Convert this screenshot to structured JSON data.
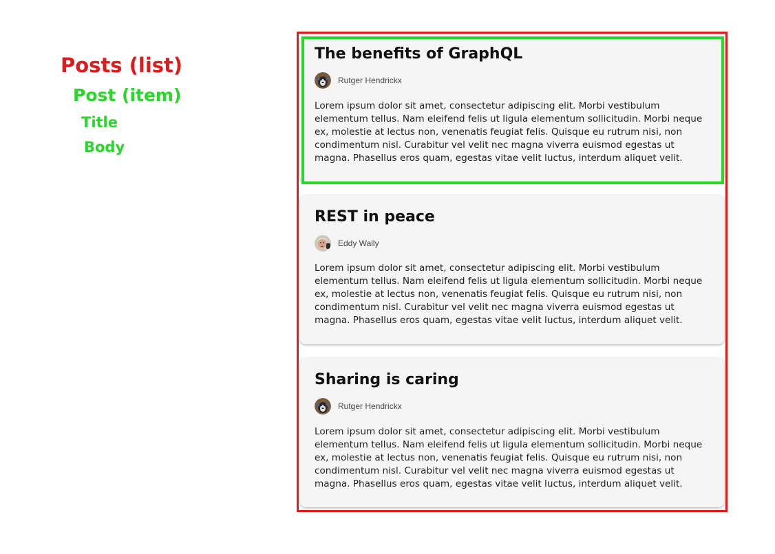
{
  "legend": {
    "list_label": "Posts (list)",
    "item_label": "Post (item)",
    "title_label": "Title",
    "body_label": "Body"
  },
  "colors": {
    "list_outline": "#e11b1b",
    "item_outline": "#2bd62b"
  },
  "posts": [
    {
      "title": "The benefits of GraphQL",
      "author": "Rutger Hendrickx",
      "avatar_icon": "dog-avatar-icon",
      "body": "Lorem ipsum dolor sit amet, consectetur adipiscing elit. Morbi vestibulum elementum tellus. Nam eleifend felis ut ligula elementum sollicitudin. Morbi neque ex, molestie at lectus non, venenatis feugiat felis. Quisque eu rutrum nisi, non condimentum nisl. Curabitur vel velit nec magna viverra euismod egestas ut magna. Phasellus eros quam, egestas vitae velit luctus, interdum aliquet velit."
    },
    {
      "title": "REST in peace",
      "author": "Eddy Wally",
      "avatar_icon": "person-avatar-icon",
      "body": "Lorem ipsum dolor sit amet, consectetur adipiscing elit. Morbi vestibulum elementum tellus. Nam eleifend felis ut ligula elementum sollicitudin. Morbi neque ex, molestie at lectus non, venenatis feugiat felis. Quisque eu rutrum nisi, non condimentum nisl. Curabitur vel velit nec magna viverra euismod egestas ut magna. Phasellus eros quam, egestas vitae velit luctus, interdum aliquet velit."
    },
    {
      "title": "Sharing is caring",
      "author": "Rutger Hendrickx",
      "avatar_icon": "dog-avatar-icon",
      "body": "Lorem ipsum dolor sit amet, consectetur adipiscing elit. Morbi vestibulum elementum tellus. Nam eleifend felis ut ligula elementum sollicitudin. Morbi neque ex, molestie at lectus non, venenatis feugiat felis. Quisque eu rutrum nisi, non condimentum nisl. Curabitur vel velit nec magna viverra euismod egestas ut magna. Phasellus eros quam, egestas vitae velit luctus, interdum aliquet velit."
    }
  ]
}
